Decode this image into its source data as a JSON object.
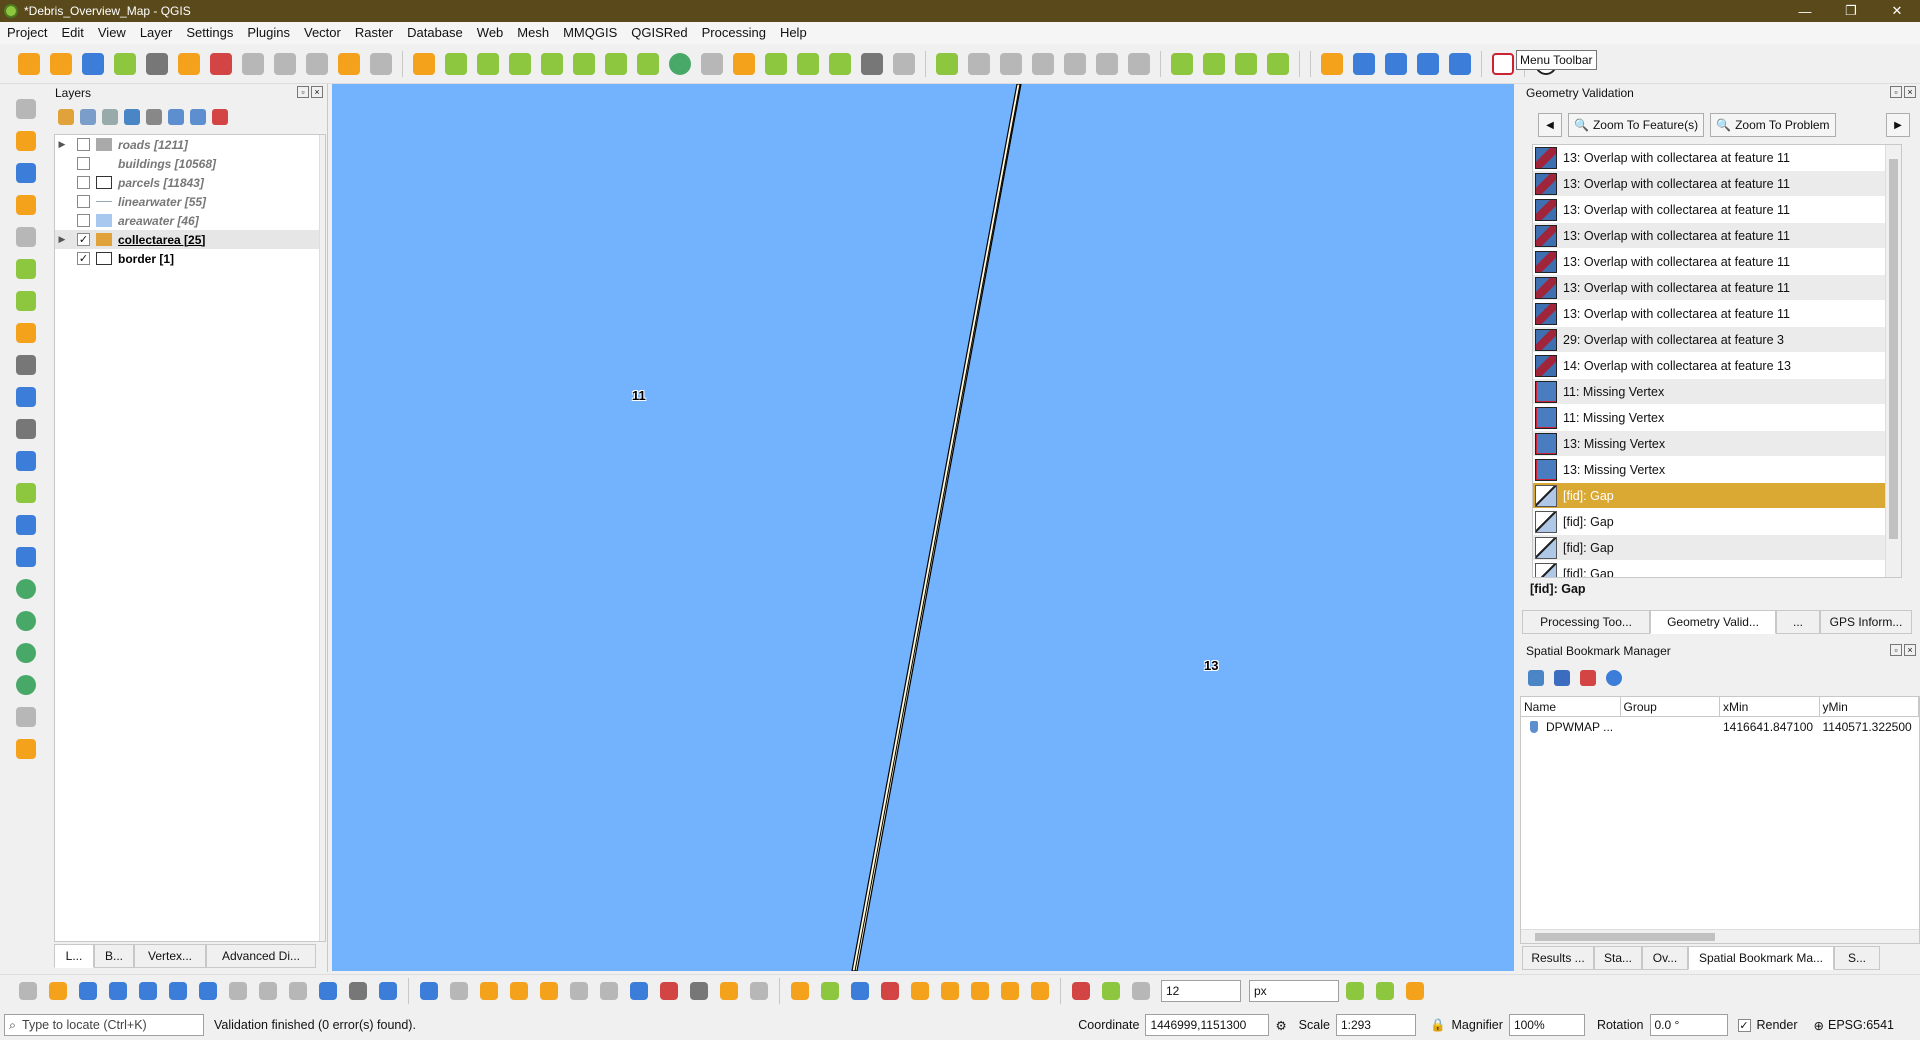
{
  "window": {
    "title": "*Debris_Overview_Map - QGIS",
    "minimize": "—",
    "maximize": "❐",
    "close": "✕"
  },
  "menubar": [
    "Project",
    "Edit",
    "View",
    "Layer",
    "Settings",
    "Plugins",
    "Vector",
    "Raster",
    "Database",
    "Web",
    "Mesh",
    "MMQGIS",
    "QGISRed",
    "Processing",
    "Help"
  ],
  "tooltip": "Menu Toolbar",
  "layers_panel": {
    "title": "Layers",
    "layers": [
      {
        "name": "roads [1211]",
        "checked": false,
        "expandable": true,
        "state": "off"
      },
      {
        "name": "buildings [10568]",
        "checked": false,
        "expandable": false,
        "state": "off"
      },
      {
        "name": "parcels [11843]",
        "checked": false,
        "expandable": false,
        "state": "off"
      },
      {
        "name": "linearwater [55]",
        "checked": false,
        "expandable": false,
        "state": "off"
      },
      {
        "name": "areawater [46]",
        "checked": false,
        "expandable": false,
        "state": "off"
      },
      {
        "name": "collectarea [25]",
        "checked": true,
        "expandable": true,
        "state": "on"
      },
      {
        "name": "border [1]",
        "checked": true,
        "expandable": false,
        "state": "on"
      }
    ],
    "tabs": [
      "L...",
      "B...",
      "Vertex...",
      "Advanced Di..."
    ]
  },
  "map": {
    "background": "#73b3fe",
    "labels": [
      "11",
      "13"
    ]
  },
  "geometry_validation": {
    "title": "Geometry Validation",
    "zoom_feature": "Zoom To Feature(s)",
    "zoom_problem": "Zoom To Problem",
    "rows": [
      {
        "text": "13: Overlap with collectarea at feature 11",
        "kind": "overlap"
      },
      {
        "text": "13: Overlap with collectarea at feature 11",
        "kind": "overlap"
      },
      {
        "text": "13: Overlap with collectarea at feature 11",
        "kind": "overlap"
      },
      {
        "text": "13: Overlap with collectarea at feature 11",
        "kind": "overlap"
      },
      {
        "text": "13: Overlap with collectarea at feature 11",
        "kind": "overlap"
      },
      {
        "text": "13: Overlap with collectarea at feature 11",
        "kind": "overlap"
      },
      {
        "text": "13: Overlap with collectarea at feature 11",
        "kind": "overlap"
      },
      {
        "text": "29: Overlap with collectarea at feature 3",
        "kind": "overlap"
      },
      {
        "text": "14: Overlap with collectarea at feature 13",
        "kind": "overlap"
      },
      {
        "text": "11: Missing Vertex",
        "kind": "vertex"
      },
      {
        "text": "11: Missing Vertex",
        "kind": "vertex"
      },
      {
        "text": "13: Missing Vertex",
        "kind": "vertex"
      },
      {
        "text": "13: Missing Vertex",
        "kind": "vertex"
      },
      {
        "text": "[fid]: Gap",
        "kind": "gap",
        "selected": true
      },
      {
        "text": "[fid]: Gap",
        "kind": "gap"
      },
      {
        "text": "[fid]: Gap",
        "kind": "gap"
      },
      {
        "text": "[fid]: Gap",
        "kind": "gap"
      }
    ],
    "selected_label": "[fid]: Gap",
    "tabs": [
      "Processing Too...",
      "Geometry Valid...",
      "...",
      "GPS Inform..."
    ]
  },
  "bookmarks": {
    "title": "Spatial Bookmark Manager",
    "columns": [
      "Name",
      "Group",
      "xMin",
      "yMin"
    ],
    "rows": [
      {
        "name": "DPWMAP ...",
        "group": "",
        "xmin": "1416641.847100",
        "ymin": "1140571.322500"
      }
    ],
    "tabs": [
      "Results ...",
      "Sta...",
      "Ov...",
      "Spatial Bookmark Ma...",
      "S..."
    ]
  },
  "bottom_toolbar": {
    "snap_tolerance": "12",
    "snap_units": "px"
  },
  "statusbar": {
    "locator_placeholder": "Type to locate (Ctrl+K)",
    "message": "Validation finished (0 error(s) found).",
    "coordinate_label": "Coordinate",
    "coordinate": "1446999,1151300",
    "scale_label": "Scale",
    "scale": "1:293",
    "magnifier_label": "Magnifier",
    "magnifier": "100%",
    "rotation_label": "Rotation",
    "rotation": "0.0 °",
    "render_label": "Render",
    "crs": "EPSG:6541"
  }
}
